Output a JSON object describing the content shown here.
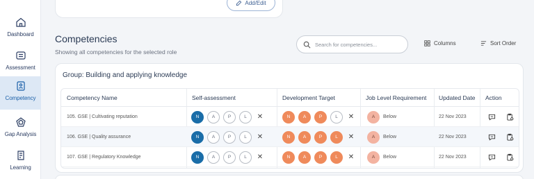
{
  "sidebar": {
    "items": [
      {
        "label": "Dashboard",
        "icon": "home-icon",
        "active": false
      },
      {
        "label": "Assessment",
        "icon": "assessment-icon",
        "active": false
      },
      {
        "label": "Competency",
        "icon": "competency-icon",
        "active": true
      },
      {
        "label": "Gap Analysis",
        "icon": "gap-analysis-icon",
        "active": false
      },
      {
        "label": "Learning",
        "icon": "learning-icon",
        "active": false
      }
    ]
  },
  "top_card": {
    "add_edit_label": "Add/Edit"
  },
  "page": {
    "title": "Competencies",
    "subtitle": "Showing all competencies for the selected role"
  },
  "search": {
    "placeholder": "Search for competencies..."
  },
  "toolbar": {
    "columns_label": "Columns",
    "sort_label": "Sort Order"
  },
  "group": {
    "title": "Group: Building and applying knowledge",
    "columns": [
      "Competency Name",
      "Self-assessment",
      "Development Target",
      "Job Level Requirement",
      "Updated Date",
      "Action"
    ],
    "rows": [
      {
        "name": "105. GSE | Cultivating reputation",
        "self": [
          "N",
          "A",
          "P",
          "L"
        ],
        "self_level": 1,
        "target": [
          "N",
          "A",
          "P",
          "L"
        ],
        "target_level": 3,
        "req_badge": "A",
        "req_text": "Below",
        "date": "22 Nov 2023"
      },
      {
        "name": "106. GSE | Quality assurance",
        "self": [
          "N",
          "A",
          "P",
          "L"
        ],
        "self_level": 1,
        "target": [
          "N",
          "A",
          "P",
          "L"
        ],
        "target_level": 4,
        "req_badge": "A",
        "req_text": "Below",
        "date": "22 Nov 2023"
      },
      {
        "name": "107. GSE | Regulatory Knowledge",
        "self": [
          "N",
          "A",
          "P",
          "L"
        ],
        "self_level": 1,
        "target": [
          "N",
          "A",
          "P",
          "L"
        ],
        "target_level": 4,
        "req_badge": "A",
        "req_text": "Below",
        "date": "22 Nov 2023"
      }
    ]
  },
  "colors": {
    "accent": "#1a6da8",
    "target": "#ef8a5b",
    "requirement": "#f3b3a1",
    "active_nav": "#dde8f5"
  }
}
